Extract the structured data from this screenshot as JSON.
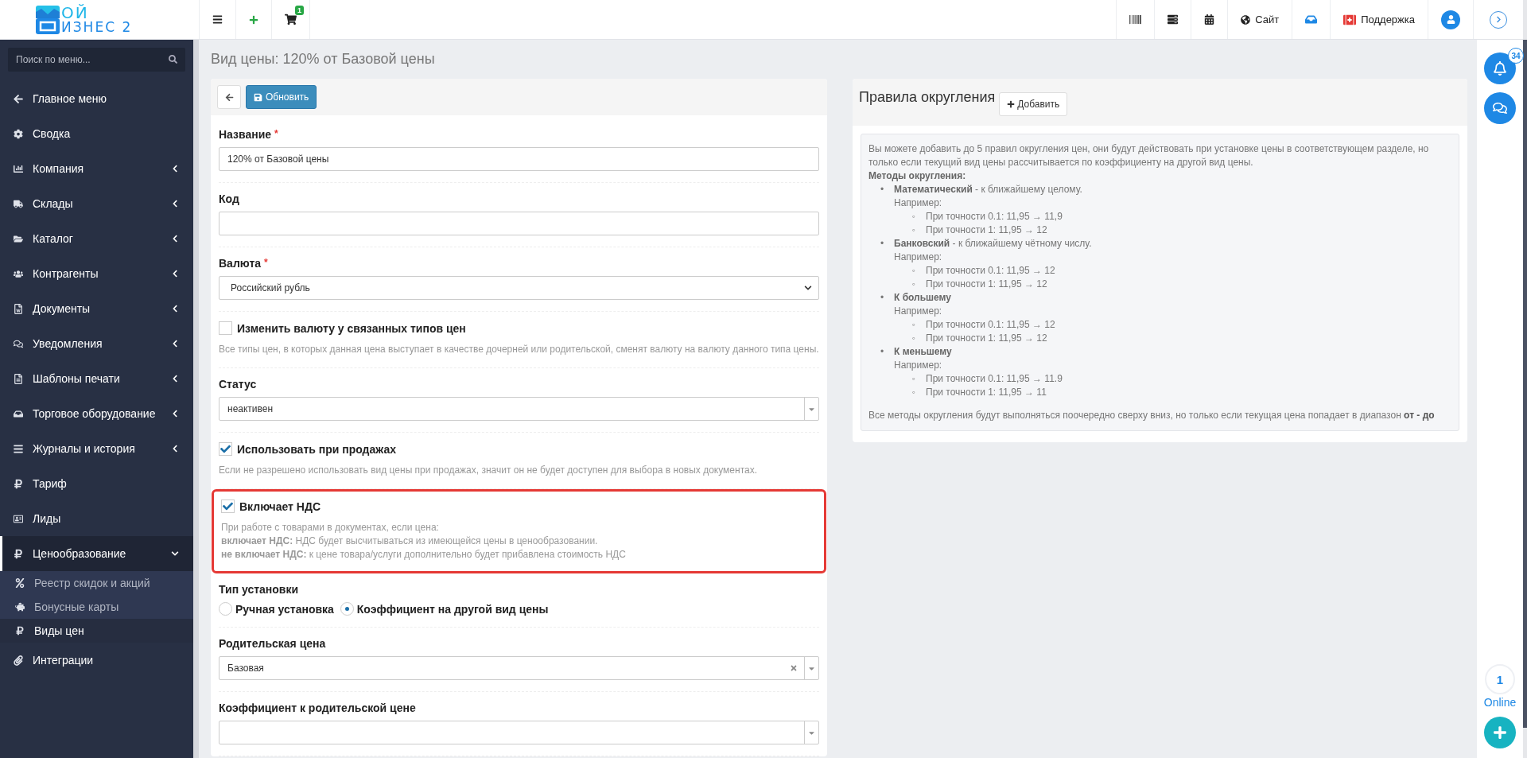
{
  "logo": {
    "line1": "ОЙ",
    "line2": "ИЗНЕС 2"
  },
  "topbar": {
    "cart_badge": "1",
    "site_label": "Сайт",
    "support_label": "Поддержка"
  },
  "sidebar": {
    "search_placeholder": "Поиск по меню...",
    "items": [
      {
        "kind": "link",
        "label": "Главное меню",
        "selected": false
      },
      {
        "kind": "link",
        "label": "Сводка",
        "selected": false
      },
      {
        "kind": "group",
        "label": "Компания",
        "expanded": false,
        "selected": false
      },
      {
        "kind": "group",
        "label": "Склады",
        "expanded": false,
        "selected": false
      },
      {
        "kind": "group",
        "label": "Каталог",
        "expanded": false,
        "selected": false
      },
      {
        "kind": "group",
        "label": "Контрагенты",
        "expanded": false,
        "selected": false
      },
      {
        "kind": "group",
        "label": "Документы",
        "expanded": false,
        "selected": false
      },
      {
        "kind": "group",
        "label": "Уведомления",
        "expanded": false,
        "selected": false
      },
      {
        "kind": "group",
        "label": "Шаблоны печати",
        "expanded": false,
        "selected": false
      },
      {
        "kind": "group",
        "label": "Торговое оборудование",
        "expanded": false,
        "selected": false
      },
      {
        "kind": "group",
        "label": "Журналы и история",
        "expanded": false,
        "selected": false
      },
      {
        "kind": "link",
        "label": "Тариф",
        "selected": false
      },
      {
        "kind": "link",
        "label": "Лиды",
        "selected": false
      },
      {
        "kind": "group",
        "label": "Ценообразование",
        "expanded": true,
        "selected": true,
        "children": [
          {
            "label": "Реестр скидок и акций",
            "selected": false
          },
          {
            "label": "Бонусные карты",
            "selected": false
          },
          {
            "label": "Виды цен",
            "selected": true
          }
        ]
      },
      {
        "kind": "link",
        "label": "Интеграции",
        "selected": false
      }
    ]
  },
  "page_title": "Вид цены: 120% от Базовой цены",
  "form": {
    "save_button": "Обновить",
    "fields": [
      {
        "kind": "text",
        "label": "Название",
        "required_mark": "*",
        "value": "120% от Базовой цены"
      },
      {
        "kind": "text",
        "label": "Код"
      },
      {
        "kind": "select",
        "label": "Валюта",
        "required_mark": "*",
        "value": "Российский рубль"
      },
      {
        "kind": "checkbox",
        "label": "Изменить валюту у связанных типов цен",
        "checked": false,
        "highlighted": false,
        "help": [
          "Все типы цен, в которых данная цена выступает в качестве дочерней или родительской, сменят валюту на валюту данного типа цены."
        ]
      },
      {
        "kind": "combo",
        "label": "Статус",
        "value": "неактивен",
        "clearable": false
      },
      {
        "kind": "checkbox",
        "label": "Использовать при продажах",
        "checked": true,
        "highlighted": false,
        "help": [
          "Если не разрешено использовать вид цены при продажах, значит он не будет доступен для выбора в новых документах."
        ]
      },
      {
        "kind": "checkbox",
        "label": "Включает НДС",
        "checked": true,
        "highlighted": true,
        "help": [
          "При работе с товарами в документах, если цена:",
          "**включает НДС:** НДС будет высчитываться из имеющейся цены в ценообразовании.",
          "**не включает НДС:** к цене товара/услуги дополнительно будет прибавлена стоимость НДС"
        ]
      },
      {
        "kind": "radio",
        "label": "Тип установки",
        "options": [
          {
            "label": "Ручная установка",
            "selected": false
          },
          {
            "label": "Коэффициент на другой вид цены",
            "selected": true
          }
        ]
      },
      {
        "kind": "combo",
        "label": "Родительская цена",
        "value": "Базовая",
        "clearable": true
      },
      {
        "kind": "combo",
        "label": "Коэффициент к родительской цене",
        "clearable": false
      }
    ]
  },
  "rounding": {
    "title": "Правила округления",
    "add_button": "Добавить",
    "intro": "Вы можете добавить до 5 правил округления цен, они будут действовать при установке цены в соответствующем разделе, но только если текущий вид цены рассчитывается по коэффициенту на другой вид цены.",
    "methods_title": "Методы округления:",
    "methods": [
      {
        "marker": "•",
        "name": "Математический",
        "description": "- к ближайшему целому.",
        "example_label": "Например:",
        "examples": [
          {
            "marker": "◦",
            "text": "При точности 0.1: 11,95 → 11,9"
          },
          {
            "marker": "◦",
            "text": "При точности 1: 11,95 → 12"
          }
        ]
      },
      {
        "marker": "•",
        "name": "Банковский",
        "description": "- к ближайшему чётному числу.",
        "example_label": "Например:",
        "examples": [
          {
            "marker": "◦",
            "text": "При точности 0.1: 11,95 → 12"
          },
          {
            "marker": "◦",
            "text": "При точности 1: 11,95 → 12"
          }
        ]
      },
      {
        "marker": "•",
        "name": "К большему",
        "example_label": "Например:",
        "examples": [
          {
            "marker": "◦",
            "text": "При точности 0.1: 11,95 → 12"
          },
          {
            "marker": "◦",
            "text": "При точности 1: 11,95 → 12"
          }
        ]
      },
      {
        "marker": "•",
        "name": "К меньшему",
        "example_label": "Например:",
        "examples": [
          {
            "marker": "◦",
            "text": "При точности 0.1: 11,95 → 11.9"
          },
          {
            "marker": "◦",
            "text": "При точности 1: 11,95 → 11"
          }
        ]
      }
    ],
    "footer": "Все методы округления будут выполняться поочередно сверху вниз, но только если текущая цена попадает в диапазон **от - до**"
  },
  "rail": {
    "notifications_badge": "34",
    "online_count": "1",
    "online_label": "Online"
  }
}
